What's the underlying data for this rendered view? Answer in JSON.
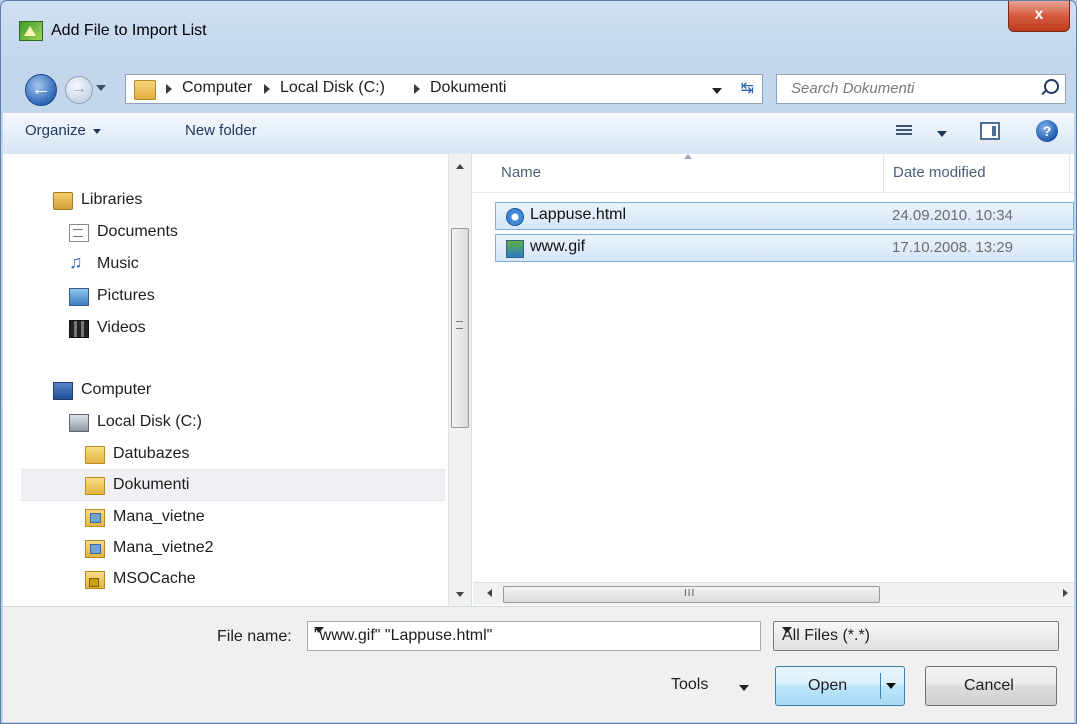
{
  "window": {
    "title": "Add File to Import List",
    "close_label": "x"
  },
  "address": {
    "crumbs": [
      "Computer",
      "Local Disk (C:)",
      "Dokumenti"
    ],
    "search_placeholder": "Search Dokumenti"
  },
  "toolbar": {
    "organize": "Organize",
    "new_folder": "New folder",
    "help": "?"
  },
  "nav": {
    "items": [
      {
        "label": "Libraries",
        "icon": "libraries-icon"
      },
      {
        "label": "Documents",
        "icon": "documents-icon"
      },
      {
        "label": "Music",
        "icon": "music-icon"
      },
      {
        "label": "Pictures",
        "icon": "pictures-icon"
      },
      {
        "label": "Videos",
        "icon": "videos-icon"
      },
      {
        "label": "Computer",
        "icon": "computer-icon"
      },
      {
        "label": "Local Disk (C:)",
        "icon": "disk-icon"
      },
      {
        "label": "Datubazes",
        "icon": "folder-icon"
      },
      {
        "label": "Dokumenti",
        "icon": "folder-icon",
        "selected": true
      },
      {
        "label": "Mana_vietne",
        "icon": "web-folder-icon"
      },
      {
        "label": "Mana_vietne2",
        "icon": "web-folder-icon"
      },
      {
        "label": "MSOCache",
        "icon": "locked-folder-icon"
      }
    ]
  },
  "files": {
    "columns": {
      "name": "Name",
      "date": "Date modified"
    },
    "rows": [
      {
        "name": "Lappuse.html",
        "date": "24.09.2010. 10:34",
        "icon": "ie-html-icon",
        "selected": true
      },
      {
        "name": "www.gif",
        "date": "17.10.2008. 13:29",
        "icon": "gif-image-icon",
        "selected": true
      }
    ]
  },
  "bottom": {
    "file_name_label": "File name:",
    "file_name_value": "\"www.gif\" \"Lappuse.html\"",
    "file_type": "All Files (*.*)",
    "tools": "Tools",
    "open": "Open",
    "cancel": "Cancel"
  },
  "colors": {
    "selection_bg": "#d6e7f9",
    "selection_border": "#84acdd",
    "chrome": "#c3d6ec"
  }
}
